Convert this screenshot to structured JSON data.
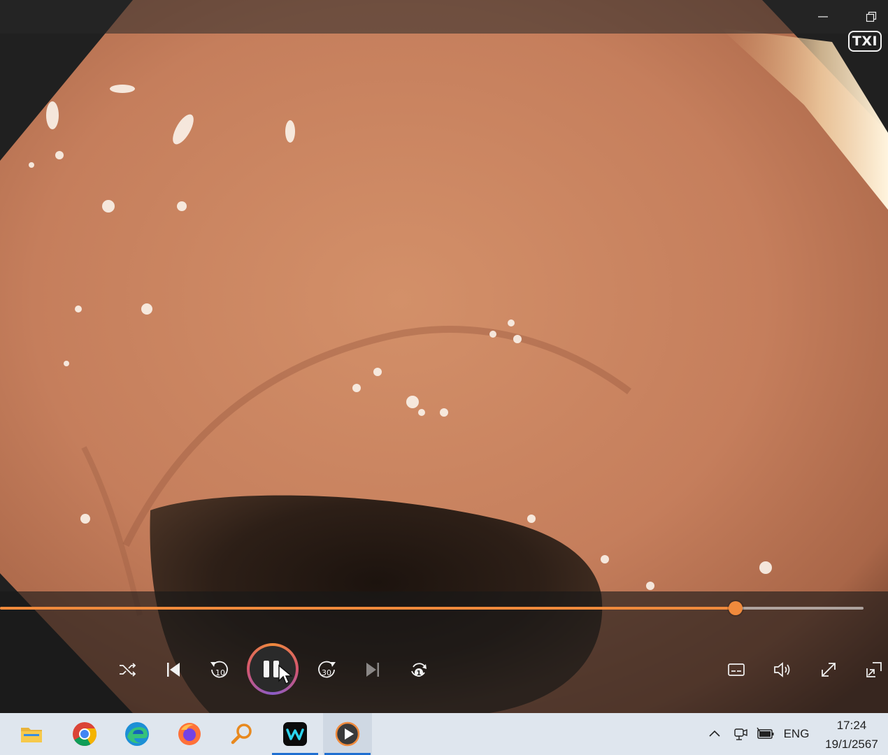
{
  "window": {
    "minimize_icon": "minimize-icon",
    "restore_icon": "restore-icon"
  },
  "overlay": {
    "badge_text": "TXI"
  },
  "player": {
    "progress_fraction": 0.852,
    "state": "playing",
    "accent_color": "#f08a3c",
    "controls_left": [
      {
        "name": "shuffle-icon"
      },
      {
        "name": "previous-icon"
      },
      {
        "name": "skip-back-10-icon",
        "text": "10"
      },
      {
        "name": "pause-icon"
      },
      {
        "name": "skip-forward-30-icon",
        "text": "30"
      },
      {
        "name": "next-icon"
      },
      {
        "name": "repeat-one-icon",
        "text": "1"
      }
    ],
    "controls_right": [
      {
        "name": "subtitles-icon"
      },
      {
        "name": "volume-icon"
      },
      {
        "name": "fullscreen-icon"
      },
      {
        "name": "mini-player-icon"
      }
    ]
  },
  "taskbar": {
    "apps": [
      {
        "name": "file-explorer-icon"
      },
      {
        "name": "chrome-icon"
      },
      {
        "name": "edge-icon"
      },
      {
        "name": "firefox-icon"
      },
      {
        "name": "search-app-icon"
      },
      {
        "name": "webex-icon"
      },
      {
        "name": "media-player-icon"
      }
    ],
    "tray": {
      "language": "ENG",
      "time": "17:24",
      "date": "19/1/2567"
    }
  }
}
